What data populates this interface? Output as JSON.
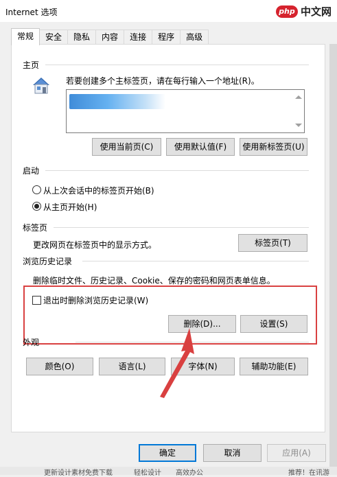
{
  "window": {
    "title": "Internet 选项"
  },
  "watermark": {
    "badge": "php",
    "text": "中文网"
  },
  "tabs": [
    "常规",
    "安全",
    "隐私",
    "内容",
    "连接",
    "程序",
    "高级"
  ],
  "home": {
    "label": "主页",
    "hint": "若要创建多个主标签页，请在每行输入一个地址(R)。",
    "buttons": {
      "current": "使用当前页(C)",
      "default": "使用默认值(F)",
      "newtab": "使用新标签页(U)"
    }
  },
  "startup": {
    "label": "启动",
    "options": [
      "从上次会话中的标签页开始(B)",
      "从主页开始(H)"
    ],
    "selected_index": 1
  },
  "tabs_section": {
    "label": "标签页",
    "desc": "更改网页在标签页中的显示方式。",
    "button": "标签页(T)"
  },
  "history": {
    "label": "浏览历史记录",
    "desc": "删除临时文件、历史记录、Cookie、保存的密码和网页表单信息。",
    "checkbox": "退出时删除浏览历史记录(W)",
    "checked": false,
    "delete_button": "删除(D)...",
    "settings_button": "设置(S)"
  },
  "appearance": {
    "label": "外观",
    "buttons": [
      "颜色(O)",
      "语言(L)",
      "字体(N)",
      "辅助功能(E)"
    ]
  },
  "dialog_buttons": {
    "ok": "确定",
    "cancel": "取消",
    "apply": "应用(A)"
  },
  "background_text": {
    "left": "更新设计素材免费下载",
    "mid": "轻松设计",
    "mid2": "高效办公",
    "right": "推荐！在讯游"
  },
  "colors": {
    "highlight_red": "#d94040",
    "tab_border": "#c8c8c8"
  },
  "icons": [
    "home-icon",
    "arrow-annotation"
  ]
}
